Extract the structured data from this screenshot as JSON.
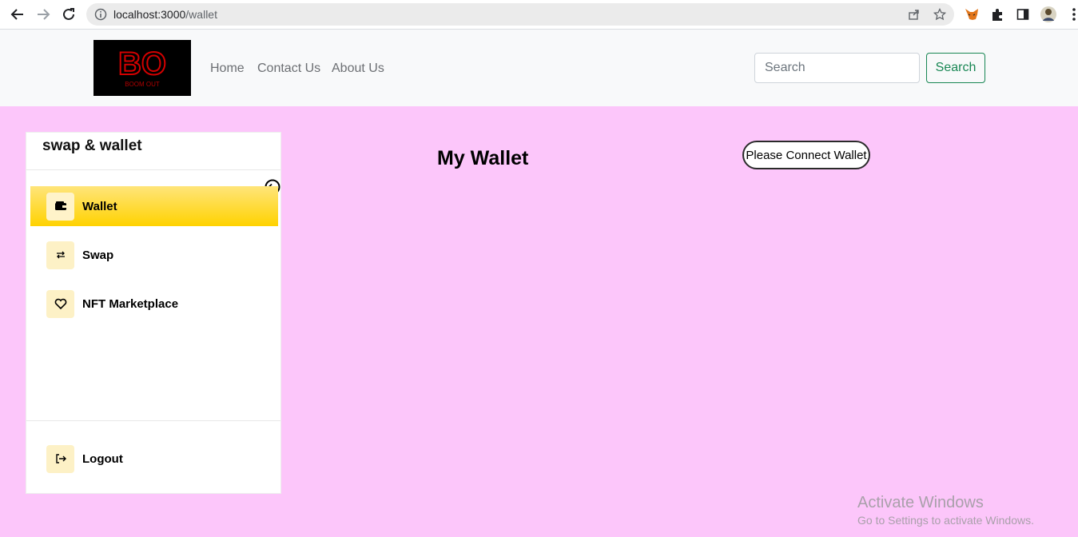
{
  "browser": {
    "url_host": "localhost:3000",
    "url_path": "/wallet"
  },
  "header": {
    "logo_text": "BO",
    "logo_subtext": "BOOM OUT",
    "nav": [
      "Home",
      "Contact Us",
      "About Us"
    ],
    "search_placeholder": "Search",
    "search_button": "Search"
  },
  "sidebar": {
    "title": "swap & wallet",
    "items": [
      {
        "label": "Wallet",
        "icon": "wallet-icon",
        "active": true
      },
      {
        "label": "Swap",
        "icon": "swap-icon",
        "active": false
      },
      {
        "label": "NFT Marketplace",
        "icon": "heart-icon",
        "active": false
      }
    ],
    "logout": "Logout"
  },
  "main": {
    "title": "My Wallet",
    "connect_button": "Please Connect Wallet"
  },
  "watermark": {
    "title": "Activate Windows",
    "subtitle": "Go to Settings to activate Windows."
  },
  "colors": {
    "page_bg": "#fcc6fa",
    "active_item": "#ffd200",
    "search_accent": "#198754"
  }
}
